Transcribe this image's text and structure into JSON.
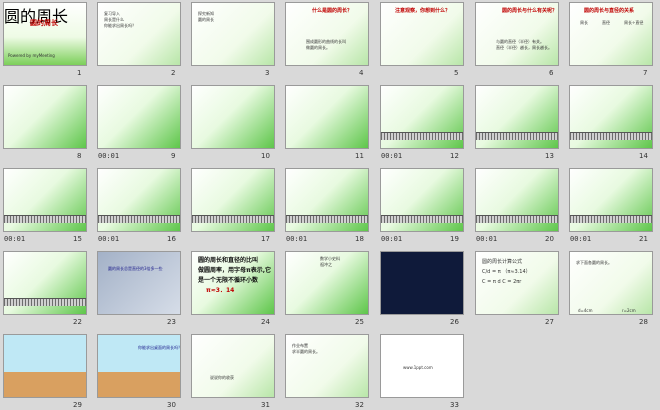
{
  "window": {
    "background": "#d9d9d9"
  },
  "slides": [
    {
      "n": "1",
      "title": "圆的周长",
      "footer": "Powered by myMeeting"
    },
    {
      "n": "2",
      "lines": [
        "复习导入",
        "周长是什么",
        "你能求出周长吗？"
      ]
    },
    {
      "n": "3",
      "lines": [
        "探究新知",
        "圆的周长"
      ]
    },
    {
      "n": "4",
      "title": "什么是圆的周长？",
      "lines": [
        "围成圆形的曲线的长叫",
        "做圆的周长。"
      ]
    },
    {
      "n": "5",
      "title": "注意观察，你想到什么？"
    },
    {
      "n": "6",
      "title": "圆的周长与什么有关呢？",
      "lines": [
        "与圆的直径（半径）有关。",
        "直径（半径）越长，周长越长。"
      ]
    },
    {
      "n": "7",
      "title": "圆的周长与直径的关系",
      "table": [
        "周长",
        "直径",
        "周长÷直径"
      ]
    },
    {
      "n": "8"
    },
    {
      "n": "9",
      "time": "00:01"
    },
    {
      "n": "10"
    },
    {
      "n": "11"
    },
    {
      "n": "12",
      "time": "00:01"
    },
    {
      "n": "13"
    },
    {
      "n": "14"
    },
    {
      "n": "15",
      "time": "00:01"
    },
    {
      "n": "16",
      "time": "00:01"
    },
    {
      "n": "17"
    },
    {
      "n": "18",
      "time": "00:01"
    },
    {
      "n": "19",
      "time": "00:01"
    },
    {
      "n": "20",
      "time": "00:01"
    },
    {
      "n": "21",
      "time": "00:01"
    },
    {
      "n": "22"
    },
    {
      "n": "23",
      "lines": [
        "圆的周长总是直径的3倍多一些"
      ]
    },
    {
      "n": "24",
      "lines": [
        "圆的周长和直径的比叫",
        "做圆周率，用字母π表示,它",
        "是一个无限不循环小数",
        "π≈3．14"
      ]
    },
    {
      "n": "25",
      "lines": [
        "数学小史料",
        "祖冲之"
      ]
    },
    {
      "n": "26"
    },
    {
      "n": "27",
      "lines": [
        "圆的周长计算公式",
        "C/d = π （π≈3.14）",
        "C = π d    C = 2πr"
      ]
    },
    {
      "n": "28",
      "lines": [
        "求下面各圆的周长。",
        "d=4cm",
        "r=2cm"
      ]
    },
    {
      "n": "29"
    },
    {
      "n": "30",
      "lines": [
        "你能求出桌面的周长吗？"
      ]
    },
    {
      "n": "31",
      "lines": [
        "说说你的收获"
      ]
    },
    {
      "n": "32",
      "lines": [
        "作业布置",
        "求半圆的周长。"
      ]
    },
    {
      "n": "33",
      "title": "第1PPT",
      "lines": [
        "www.1ppt.com"
      ]
    }
  ]
}
